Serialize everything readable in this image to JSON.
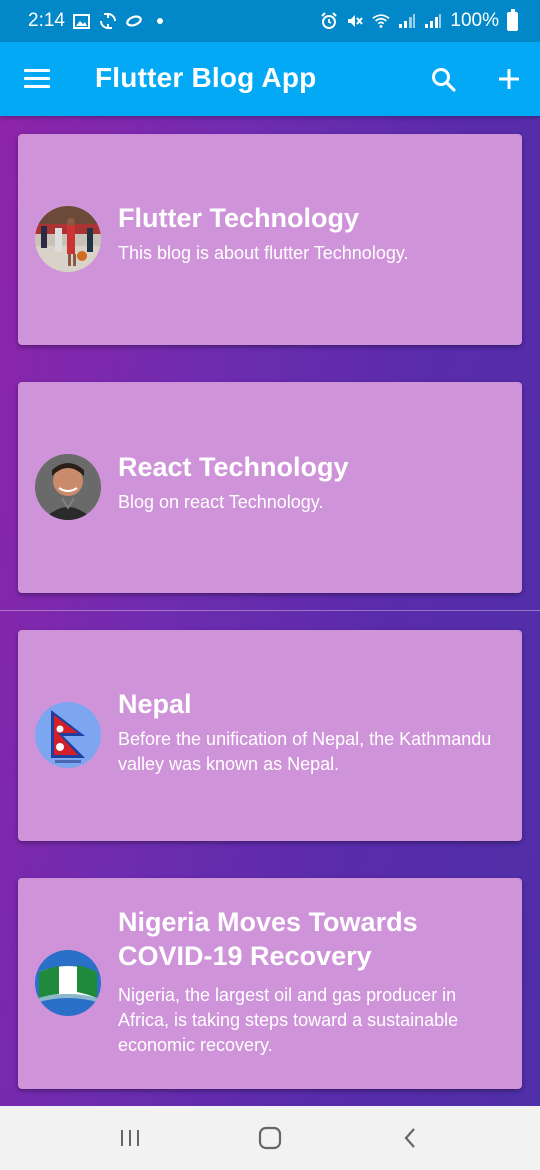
{
  "status_bar": {
    "time": "2:14",
    "battery": "100%",
    "icons": [
      "image-icon",
      "sync-icon",
      "link-icon",
      "dot-icon",
      "alarm-icon",
      "mute-icon",
      "wifi-icon",
      "signal-icon",
      "signal-icon",
      "battery-icon"
    ]
  },
  "app_bar": {
    "title": "Flutter Blog App",
    "actions": [
      "search-icon",
      "add-icon"
    ],
    "leading": "menu-icon"
  },
  "blogs": [
    {
      "title": "Flutter Technology",
      "description": "This blog is about flutter Technology.",
      "avatar": "basketball-player-photo"
    },
    {
      "title": "React Technology",
      "description": "Blog on react Technology.",
      "avatar": "man-portrait-photo"
    },
    {
      "title": "Nepal",
      "description": "Before the unification of Nepal, the Kathmandu valley was known as Nepal.",
      "avatar": "nepal-flag-image"
    },
    {
      "title": "Nigeria Moves Towards COVID-19 Recovery",
      "description": "Nigeria, the largest oil and gas producer in Africa, is taking steps toward a sustainable economic recovery.",
      "avatar": "nigeria-flag-image"
    }
  ],
  "nav_bar": [
    "recent-apps-icon",
    "home-icon",
    "back-icon"
  ],
  "colors": {
    "status_bar": "#0288c9",
    "app_bar": "#03a9f4",
    "card": "#ce93d8",
    "background_start": "#8e24aa",
    "background_end": "#4f2fa8"
  }
}
